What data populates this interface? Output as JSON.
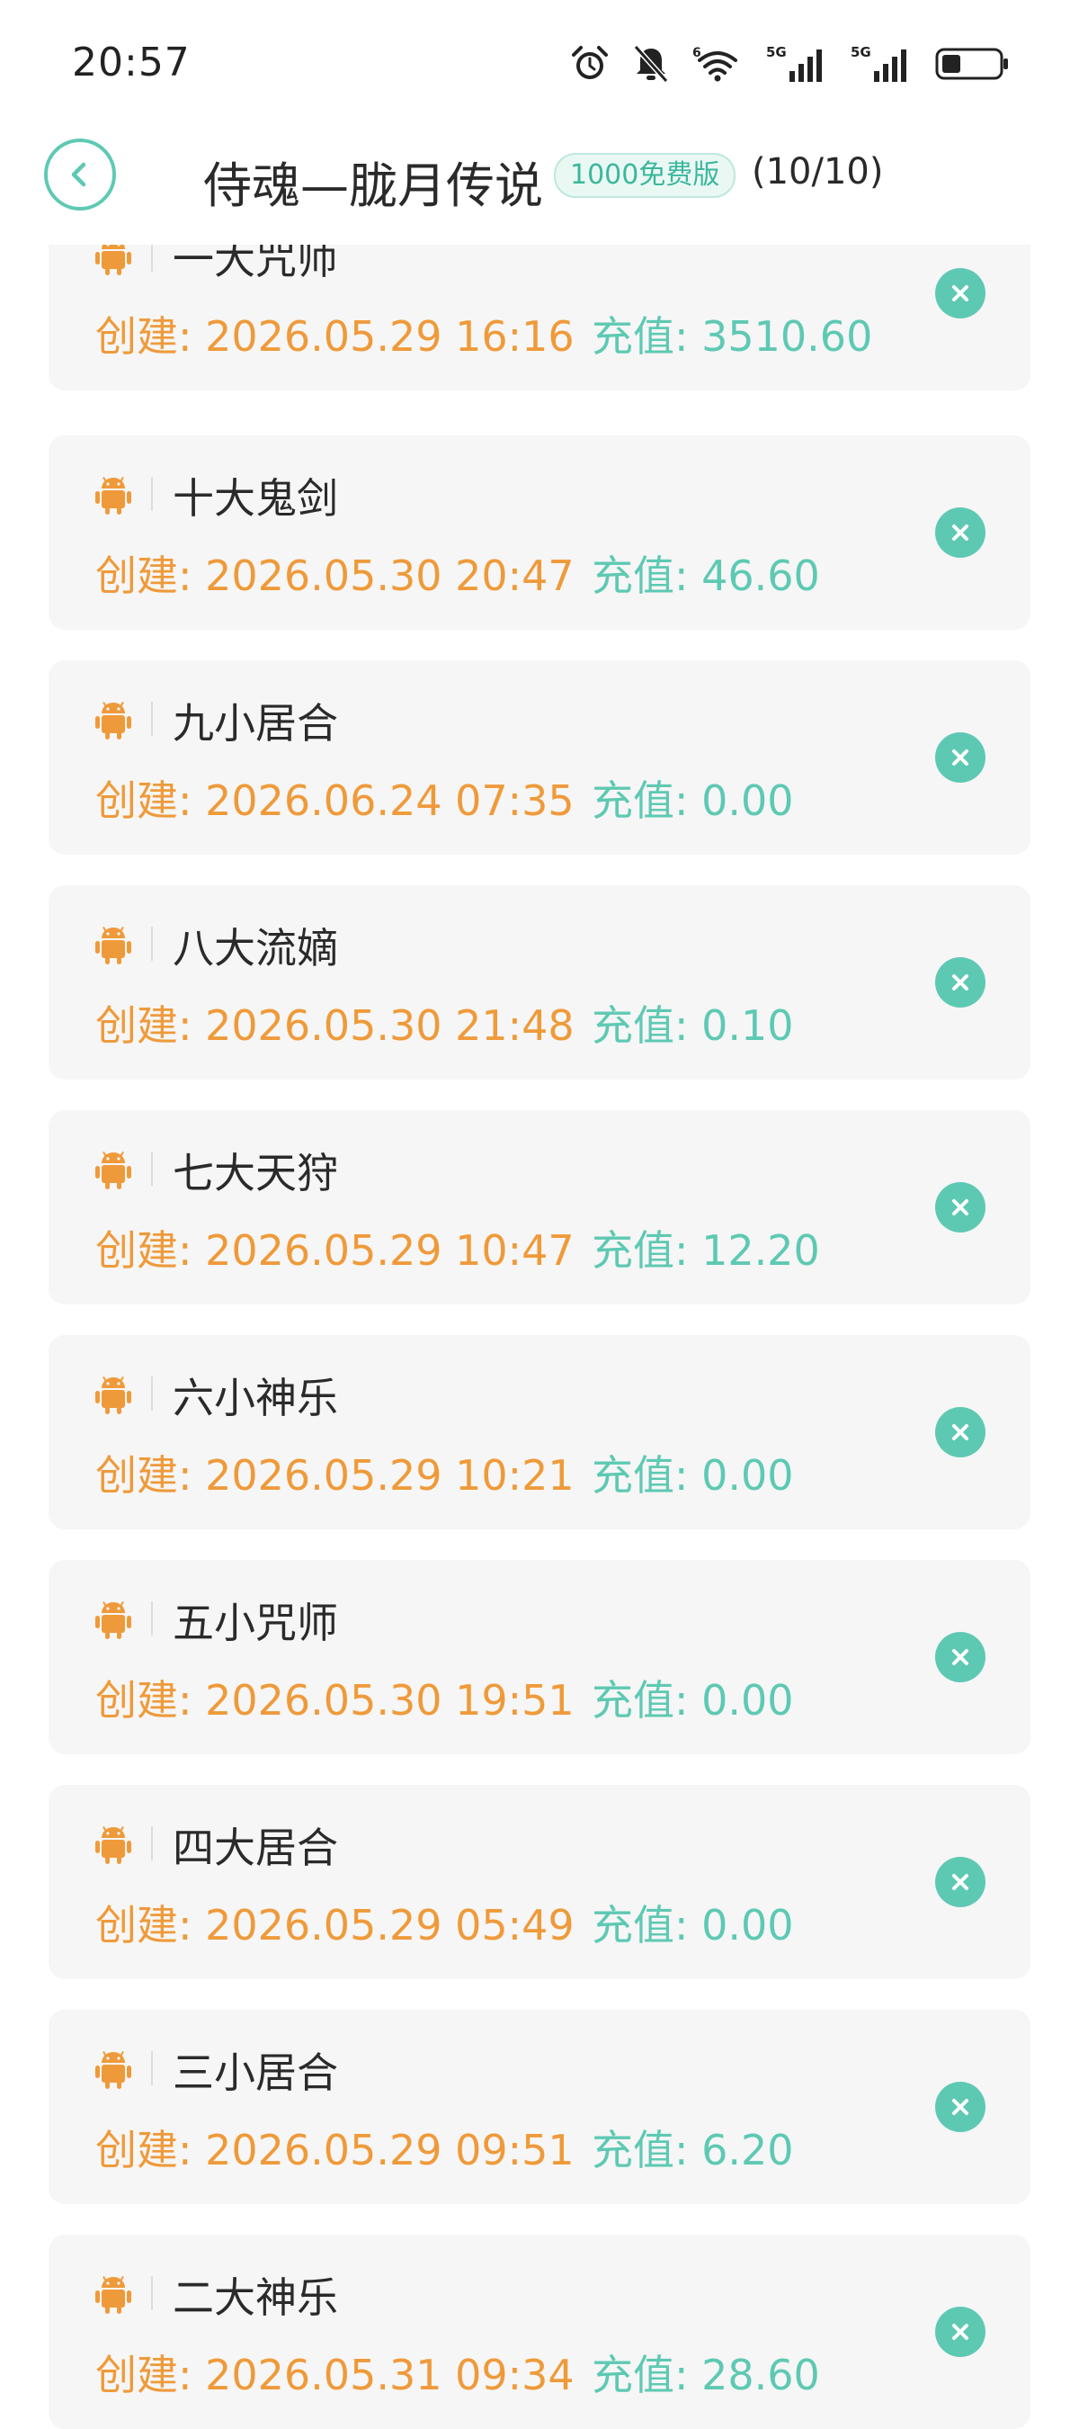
{
  "status_bar": {
    "time": "20:57",
    "icons": [
      "alarm-icon",
      "bell-off-icon",
      "wifi-icon",
      "signal-5g-icon",
      "signal-5g-icon",
      "battery-icon"
    ],
    "wifi_badge": "6",
    "network_labels": [
      "5G",
      "5G"
    ]
  },
  "header": {
    "title": "侍魂—胧月传说",
    "badge": "1000免费版",
    "count": "(10/10)",
    "back_icon": "chevron-left-icon"
  },
  "colors": {
    "accent": "#5ec9b3",
    "orange": "#ef9a3a",
    "card_bg": "#f6f6f6"
  },
  "accounts": [
    {
      "platform_icon": "android-icon",
      "name": "一大咒师",
      "created": "创建: 2026.05.29 16:16",
      "recharge": "充值: 3510.60"
    },
    {
      "platform_icon": "android-icon",
      "name": "十大鬼剑",
      "created": "创建: 2026.05.30 20:47",
      "recharge": "充值: 46.60"
    },
    {
      "platform_icon": "android-icon",
      "name": "九小居合",
      "created": "创建: 2026.06.24 07:35",
      "recharge": "充值: 0.00"
    },
    {
      "platform_icon": "android-icon",
      "name": "八大流嫡",
      "created": "创建: 2026.05.30 21:48",
      "recharge": "充值: 0.10"
    },
    {
      "platform_icon": "android-icon",
      "name": "七大天狩",
      "created": "创建: 2026.05.29 10:47",
      "recharge": "充值: 12.20"
    },
    {
      "platform_icon": "android-icon",
      "name": "六小神乐",
      "created": "创建: 2026.05.29 10:21",
      "recharge": "充值: 0.00"
    },
    {
      "platform_icon": "android-icon",
      "name": "五小咒师",
      "created": "创建: 2026.05.30 19:51",
      "recharge": "充值: 0.00"
    },
    {
      "platform_icon": "android-icon",
      "name": "四大居合",
      "created": "创建: 2026.05.29 05:49",
      "recharge": "充值: 0.00"
    },
    {
      "platform_icon": "android-icon",
      "name": "三小居合",
      "created": "创建: 2026.05.29 09:51",
      "recharge": "充值: 6.20"
    },
    {
      "platform_icon": "android-icon",
      "name": "二大神乐",
      "created": "创建: 2026.05.31 09:34",
      "recharge": "充值: 28.60"
    }
  ]
}
